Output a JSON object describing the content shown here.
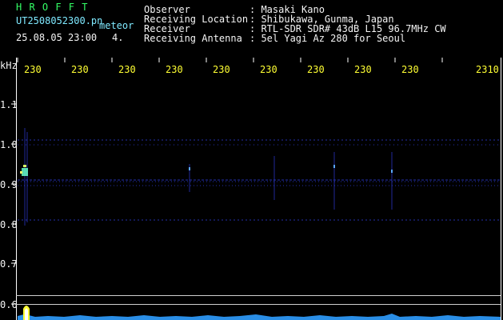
{
  "header": {
    "brand": "H R O F F T",
    "filename": "UT2508052300.pn",
    "mode": "meteor",
    "datetime": "25.08.05 23:00",
    "marker": "4.",
    "fields": [
      {
        "label": "Observer",
        "value": ": Masaki Kano"
      },
      {
        "label": "Receiving Location",
        "value": ": Shibukawa, Gunma, Japan"
      },
      {
        "label": "Receiver",
        "value": ": RTL-SDR SDR# 43dB L15 96.7MHz CW"
      },
      {
        "label": "Receiving Antenna",
        "value": ": 5el Yagi Az 280 for Seoul"
      }
    ]
  },
  "axis": {
    "y_unit": "kHz",
    "y_ticks": [
      "1.1",
      "1.0",
      "0.9",
      "0.8",
      "0.7",
      "0.6"
    ],
    "x_ticks": [
      "230",
      "230",
      "230",
      "230",
      "230",
      "230",
      "230",
      "230",
      "230",
      "2310"
    ]
  },
  "colors": {
    "trace": "#3a46ff",
    "grid": "#ffffff",
    "accent": "#ffff33",
    "brand": "#33ff66",
    "meta": "#7fe9ff"
  }
}
